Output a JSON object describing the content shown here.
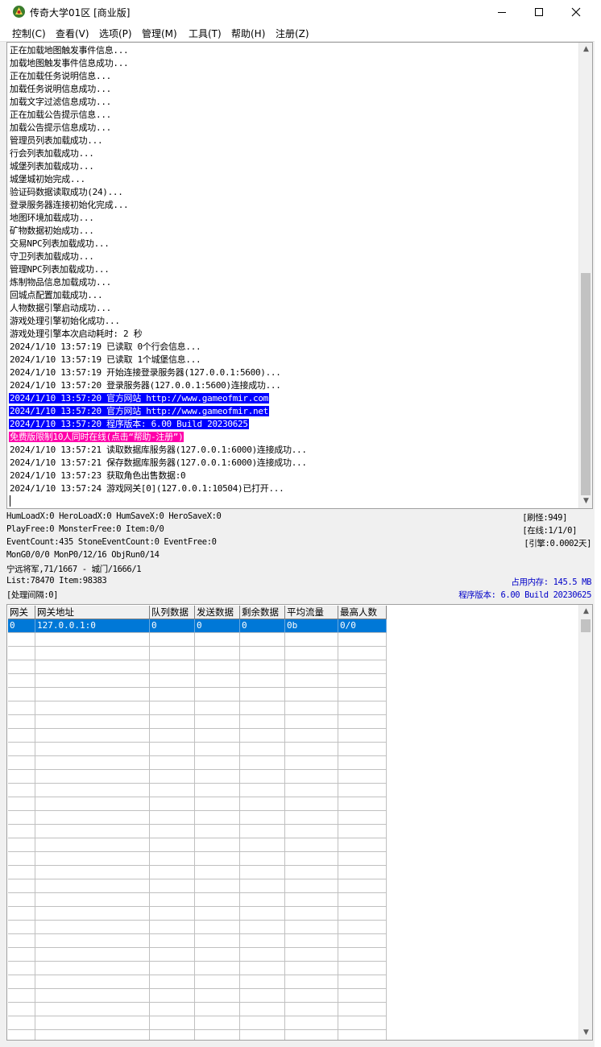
{
  "window": {
    "title": "传奇大学01区 [商业版]"
  },
  "menu": [
    "控制(C)",
    "查看(V)",
    "选项(P)",
    "管理(M)",
    "工具(T)",
    "帮助(H)",
    "注册(Z)"
  ],
  "log": [
    {
      "text": "正在加载地图触发事件信息..."
    },
    {
      "text": "加载地图触发事件信息成功..."
    },
    {
      "text": "正在加载任务说明信息..."
    },
    {
      "text": "加载任务说明信息成功..."
    },
    {
      "text": "加载文字过滤信息成功..."
    },
    {
      "text": "正在加载公告提示信息..."
    },
    {
      "text": "加载公告提示信息成功..."
    },
    {
      "text": "管理员列表加载成功..."
    },
    {
      "text": "行会列表加载成功..."
    },
    {
      "text": "城堡列表加载成功..."
    },
    {
      "text": "城堡城初始完成..."
    },
    {
      "text": "验证码数据读取成功(24)..."
    },
    {
      "text": "登录服务器连接初始化完成..."
    },
    {
      "text": "地图环境加载成功..."
    },
    {
      "text": "矿物数据初始成功..."
    },
    {
      "text": "交易NPC列表加载成功..."
    },
    {
      "text": "守卫列表加载成功..."
    },
    {
      "text": "管理NPC列表加载成功..."
    },
    {
      "text": "炼制物品信息加载成功..."
    },
    {
      "text": "回城点配置加载成功..."
    },
    {
      "text": "人物数据引擎启动成功..."
    },
    {
      "text": "游戏处理引擎初始化成功..."
    },
    {
      "text": "游戏处理引擎本次启动耗时: 2 秒"
    },
    {
      "text": "2024/1/10 13:57:19 已读取 0个行会信息..."
    },
    {
      "text": "2024/1/10 13:57:19 已读取 1个城堡信息..."
    },
    {
      "text": "2024/1/10 13:57:19 开始连接登录服务器(127.0.0.1:5600)..."
    },
    {
      "text": "2024/1/10 13:57:20 登录服务器(127.0.0.1:5600)连接成功..."
    },
    {
      "text": "2024/1/10 13:57:20 官方网站 http://www.gameofmir.com",
      "hl": "blue"
    },
    {
      "text": "2024/1/10 13:57:20 官方网站 http://www.gameofmir.net",
      "hl": "blue"
    },
    {
      "text": "2024/1/10 13:57:20 程序版本: 6.00 Build 20230625",
      "hl": "blue"
    },
    {
      "text": "免费版限制10人同时在线(点击“帮助-注册”)",
      "hl": "pink"
    },
    {
      "text": "2024/1/10 13:57:21 读取数据库服务器(127.0.0.1:6000)连接成功..."
    },
    {
      "text": "2024/1/10 13:57:21 保存数据库服务器(127.0.0.1:6000)连接成功..."
    },
    {
      "text": "2024/1/10 13:57:23 获取角色出售数据:0"
    },
    {
      "text": "2024/1/10 13:57:24 游戏网关[0](127.0.0.1:10504)已打开..."
    }
  ],
  "status": {
    "row1": "HumLoadX:0 HeroLoadX:0 HumSaveX:0 HeroSaveX:0",
    "row2": "PlayFree:0 MonsterFree:0 Item:0/0",
    "row3": "EventCount:435 StoneEventCount:0 EventFree:0",
    "row4": "MonG0/0/0 MonP0/12/16 ObjRun0/14",
    "row5": "宁远将军,71/1667 - 城门/1666/1",
    "row6": "List:78470 Item:98383",
    "row7": "[处理间隔:0]",
    "refresh": "[刷怪:949]",
    "online": "[在线:1/1/0]",
    "engine": "[引擎:0.0002天]",
    "memory": "占用内存: 145.5 MB",
    "version": "程序版本: 6.00 Build 20230625"
  },
  "gateway_table": {
    "columns": [
      "网关",
      "网关地址",
      "队列数据",
      "发送数据",
      "剩余数据",
      "平均流量",
      "最高人数"
    ],
    "rows": [
      [
        "0",
        "127.0.0.1:0",
        "0",
        "0",
        "0",
        "0b",
        "0/0"
      ]
    ]
  },
  "colors": {
    "selection": "#0078d7",
    "highlight_blue": "#0000ff",
    "highlight_pink": "#ff00aa",
    "status_blue": "#0000c8"
  },
  "icons": {
    "app": "app-icon",
    "minimize": "minimize-icon",
    "maximize": "maximize-icon",
    "close": "close-icon"
  }
}
